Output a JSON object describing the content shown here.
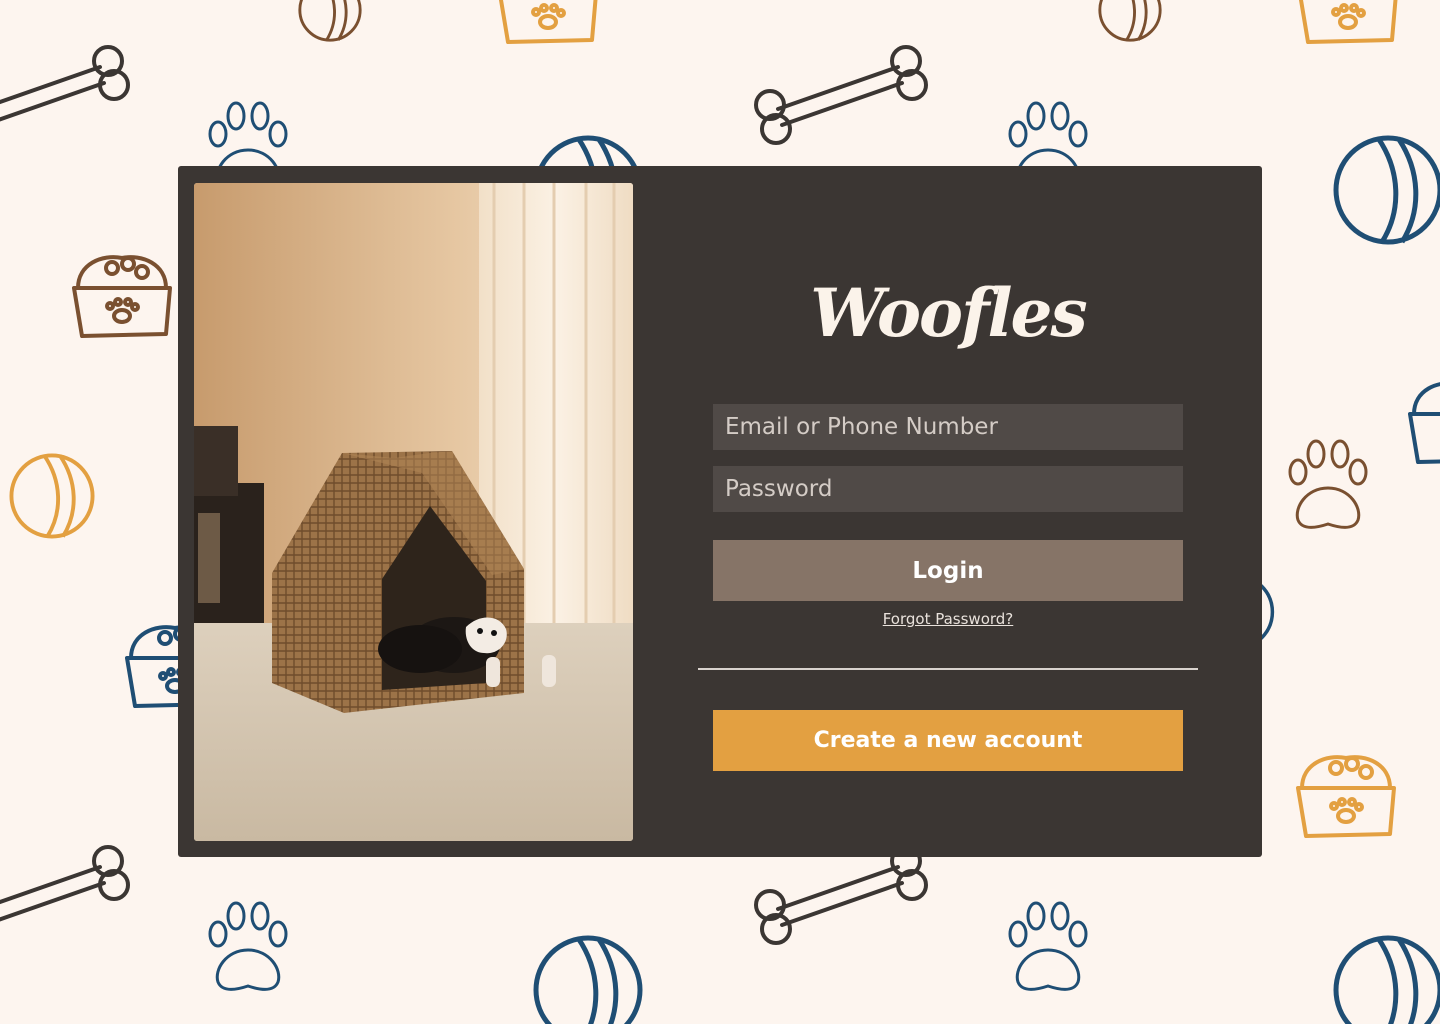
{
  "brand": {
    "logo_text": "Woofles"
  },
  "login_form": {
    "email_placeholder": "Email or Phone Number",
    "email_value": "",
    "password_placeholder": "Password",
    "password_value": "",
    "login_label": "Login",
    "forgot_label": "Forgot Password?",
    "create_account_label": "Create a new account"
  },
  "theme": {
    "background": "#fdf5ef",
    "card": "#3b3633",
    "input_background": "#504a47",
    "login_button": "#867467",
    "create_button": "#e3a041",
    "icon_navy": "#1f4e74",
    "icon_brown": "#7a5030",
    "icon_orange": "#e3a041",
    "icon_dark": "#3b3633"
  },
  "icons": {
    "pattern": [
      "bone-icon",
      "paw-print-icon",
      "tennis-ball-icon",
      "pet-food-bowl-icon"
    ]
  },
  "photo": {
    "subject": "dog-in-wicker-house-photo"
  }
}
